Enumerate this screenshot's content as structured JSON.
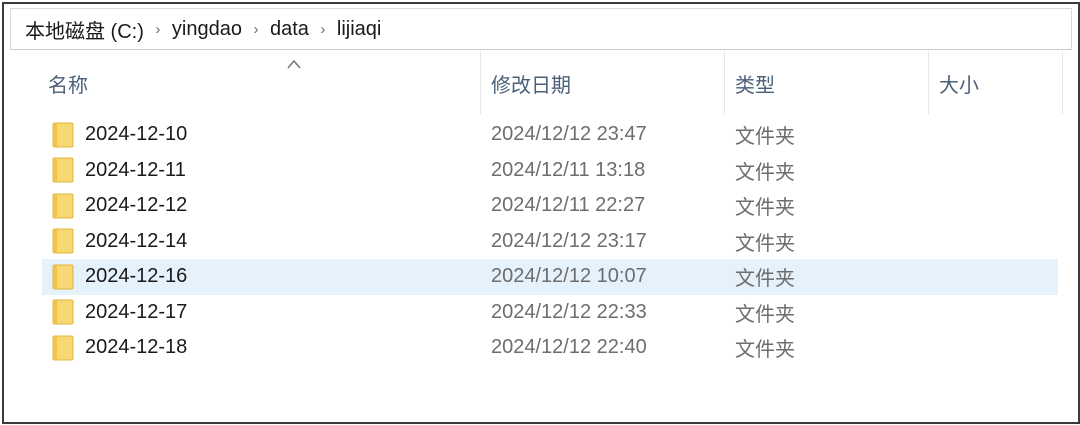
{
  "breadcrumb": [
    "本地磁盘 (C:)",
    "yingdao",
    "data",
    "lijiaqi"
  ],
  "columns": {
    "name": "名称",
    "date": "修改日期",
    "type": "类型",
    "size": "大小"
  },
  "sort_column": "name",
  "selected_row": 4,
  "rows": [
    {
      "name": "2024-12-10",
      "date": "2024/12/12 23:47",
      "type": "文件夹",
      "size": ""
    },
    {
      "name": "2024-12-11",
      "date": "2024/12/11 13:18",
      "type": "文件夹",
      "size": ""
    },
    {
      "name": "2024-12-12",
      "date": "2024/12/11 22:27",
      "type": "文件夹",
      "size": ""
    },
    {
      "name": "2024-12-14",
      "date": "2024/12/12 23:17",
      "type": "文件夹",
      "size": ""
    },
    {
      "name": "2024-12-16",
      "date": "2024/12/12 10:07",
      "type": "文件夹",
      "size": ""
    },
    {
      "name": "2024-12-17",
      "date": "2024/12/12 22:33",
      "type": "文件夹",
      "size": ""
    },
    {
      "name": "2024-12-18",
      "date": "2024/12/12 22:40",
      "type": "文件夹",
      "size": ""
    }
  ],
  "icons": {
    "row": "folder-icon",
    "separator": "chevron-right-icon",
    "sort": "sort-ascending-icon"
  },
  "colors": {
    "selected_row": "#e5f1fb",
    "header_text": "#4c607a",
    "folder": "#f8d775"
  }
}
